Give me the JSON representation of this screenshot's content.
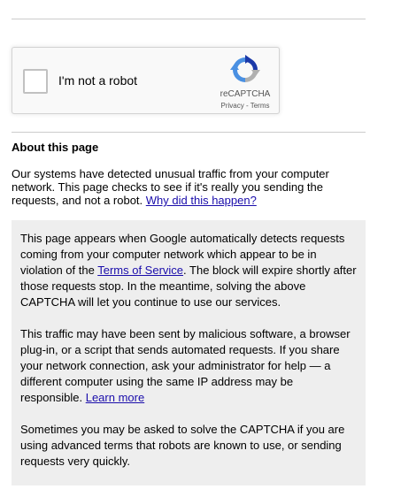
{
  "recaptcha": {
    "checkbox_label": "I'm not a robot",
    "brand": "reCAPTCHA",
    "privacy_label": "Privacy",
    "separator": "-",
    "terms_label": "Terms",
    "colors": {
      "logo_blue": "#4a90e2",
      "logo_dark_blue": "#1c3aa9",
      "logo_gray": "#b0b0b0"
    }
  },
  "about": {
    "title": "About this page",
    "intro_text": "Our systems have detected unusual traffic from your computer network. This page checks to see if it's really you sending the requests, and not a robot.",
    "why_link": "Why did this happen?"
  },
  "info": {
    "p1_text_a": "This page appears when Google automatically detects requests coming from your computer network which appear to be in violation of the ",
    "p1_link": "Terms of Service",
    "p1_text_b": ". The block will expire shortly after those requests stop. In the meantime, solving the above CAPTCHA will let you continue to use our services.",
    "p2_text_a": "This traffic may have been sent by malicious software, a browser plug-in, or a script that sends automated requests. If you share your network connection, ask your administrator for help — a different computer using the same IP address may be responsible. ",
    "p2_link": "Learn more",
    "p3_text": "Sometimes you may be asked to solve the CAPTCHA if you are using advanced terms that robots are known to use, or sending requests very quickly."
  },
  "colors": {
    "link": "#1a0dab",
    "info_bg": "#eeeeee",
    "divider": "#cccccc"
  }
}
